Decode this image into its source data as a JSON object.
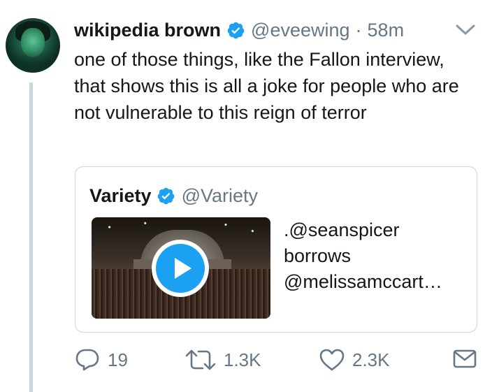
{
  "tweet": {
    "author_name": "wikipedia brown",
    "author_handle": "@eveewing",
    "separator": "·",
    "time": "58m",
    "text": "one of those things, like the Fallon interview, that shows this is all a joke for people who are not vulnerable to this reign of terror"
  },
  "quoted": {
    "author_name": "Variety",
    "author_handle": "@Variety",
    "text": ".@seanspicer borrows @melissamccart…"
  },
  "actions": {
    "replies": "19",
    "retweets": "1.3K",
    "likes": "2.3K"
  },
  "icons": {
    "verified": "verified-badge-icon",
    "caret": "chevron-down-icon",
    "reply": "reply-icon",
    "retweet": "retweet-icon",
    "like": "heart-icon",
    "dm": "envelope-icon",
    "play": "play-icon"
  },
  "colors": {
    "accent": "#1da1f2",
    "text": "#14171a",
    "muted": "#657786",
    "border": "#ccd6dd"
  }
}
